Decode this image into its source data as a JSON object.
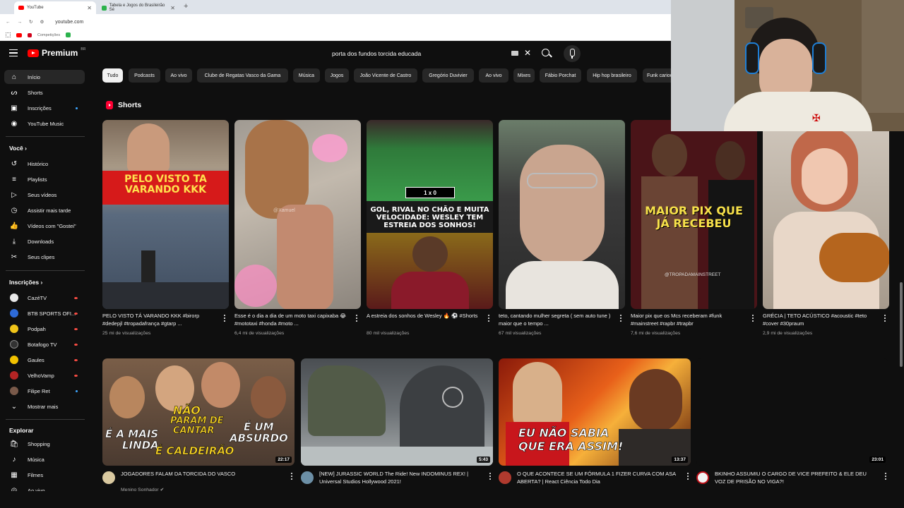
{
  "browser": {
    "tabs": [
      {
        "label": "YouTube",
        "active": true
      },
      {
        "label": "Tabela e Jogos do Brasileirão Sé",
        "active": false
      }
    ],
    "url": "youtube.com",
    "bookmark": "Competições"
  },
  "header": {
    "logo": "Premium",
    "region": "BR",
    "search_value": "porta dos fundos torcida educada"
  },
  "sidebar": {
    "main": [
      {
        "label": "Início",
        "icon": "home-icon",
        "active": true
      },
      {
        "label": "Shorts",
        "icon": "shorts-icon"
      },
      {
        "label": "Inscrições",
        "icon": "subscriptions-icon",
        "dot": true
      },
      {
        "label": "YouTube Music",
        "icon": "music-icon"
      }
    ],
    "you_heading": "Você",
    "you": [
      {
        "label": "Histórico",
        "icon": "history-icon"
      },
      {
        "label": "Playlists",
        "icon": "playlists-icon"
      },
      {
        "label": "Seus vídeos",
        "icon": "your-videos-icon"
      },
      {
        "label": "Assistir mais tarde",
        "icon": "watch-later-icon"
      },
      {
        "label": "Vídeos com \"Gostei\"",
        "icon": "like-icon"
      },
      {
        "label": "Downloads",
        "icon": "download-icon"
      },
      {
        "label": "Seus clipes",
        "icon": "clips-icon"
      }
    ],
    "subs_heading": "Inscrições",
    "subs": [
      {
        "label": "CazéTV",
        "color": "#e8e8e8",
        "live": true
      },
      {
        "label": "BTB SPORTS OFI...",
        "color": "#2e6bd8",
        "live": true
      },
      {
        "label": "Podpah",
        "color": "#f0c419",
        "live": true
      },
      {
        "label": "Botafogo TV",
        "color": "#222222",
        "live": true
      },
      {
        "label": "Gaules",
        "color": "#f2c200",
        "live": true
      },
      {
        "label": "VelhoVamp",
        "color": "#b32424",
        "live": true
      },
      {
        "label": "Filipe Ret",
        "color": "#7a5a4a",
        "dot": true
      }
    ],
    "show_more": "Mostrar mais",
    "explore_heading": "Explorar",
    "explore": [
      {
        "label": "Shopping",
        "icon": "shopping-icon"
      },
      {
        "label": "Música",
        "icon": "music-note-icon"
      },
      {
        "label": "Filmes",
        "icon": "film-icon"
      },
      {
        "label": "Ao vivo",
        "icon": "live-icon"
      }
    ]
  },
  "chips": [
    "Tudo",
    "Podcasts",
    "Ao vivo",
    "Clube de Regatas Vasco da Gama",
    "Música",
    "Jogos",
    "João Vicente de Castro",
    "Gregório Duvivier",
    "Ao vivo",
    "Mixes",
    "Fábio Porchat",
    "Hip hop brasileiro",
    "Funk carioca"
  ],
  "shorts_heading": "Shorts",
  "shorts": [
    {
      "title": "PELO VISTO TÁ VARANDO KKK #birorp #dedepjl #tropadafrança #gtarp ...",
      "views": "25 mi de visualizações",
      "caption": "PELO VISTO TA\nVARANDO KKK"
    },
    {
      "title": "Esse é o dia a dia de um  moto taxi capixaba 😂 #mototaxi #honda #moto ...",
      "views": "6,4 mi de visualizações",
      "caption": ""
    },
    {
      "title": "A estreia dos sonhos de Wesley 🔥 ⚽ #Shorts",
      "views": "80 mil visualizações",
      "caption": "GOL, RIVAL NO CHÃO E MUITA\nVELOCIDADE: WESLEY TEM\nESTREIA DOS SONHOS!"
    },
    {
      "title": "teto, cantando mulher segreta ( sem auto tune ) maior que o tempo ...",
      "views": "67 mil visualizações",
      "caption": ""
    },
    {
      "title": "Maior pix que os Mcs receberam #funk #mainstreet #rapbr #trapbr",
      "views": "7,6 mi de visualizações",
      "caption": "MAIOR PIX QUE\nJÁ RECEBEU"
    },
    {
      "title": "GRÉCIA | TETO ACÚSTICO #acoustic #teto #cover #30praum",
      "views": "2,9 mi de visualizações",
      "caption": ""
    }
  ],
  "watermarks": {
    "short2": "@Xamuel",
    "short5": "@TROPADAMAINSTREET",
    "score": "1 x 0"
  },
  "videos": [
    {
      "title": "JOGADORES FALAM DA TORCIDA DO VASCO",
      "channel": "Menino Sonhador",
      "duration": "22:17",
      "thumb_text": [
        "É A MAIS",
        "LINDA",
        "NÃO",
        "PARAM DE",
        "CANTAR",
        "É UM",
        "ABSURDO",
        "É CALDEIRÃO"
      ]
    },
    {
      "title": "[NEW] JURASSIC WORLD The Ride! New INDOMINUS REX! | Universal Studios Hollywood 2021!",
      "channel": "",
      "duration": "5:43",
      "thumb_text": []
    },
    {
      "title": "O QUE ACONTECE SE UM FÓRMULA 1 FIZER CURVA COM ASA ABERTA? | React Ciência Todo Dia",
      "channel": "",
      "duration": "13:37",
      "thumb_text": [
        "EU NÃO SABIA",
        "QUE ERA ASSIM!"
      ]
    },
    {
      "title": "BKINHO ASSUMIU O CARGO DE VICE PREFEITO & ELE DEU VOZ DE PRISÃO NO VIGA?!",
      "channel": "",
      "duration": "23:01",
      "thumb_text": []
    }
  ]
}
